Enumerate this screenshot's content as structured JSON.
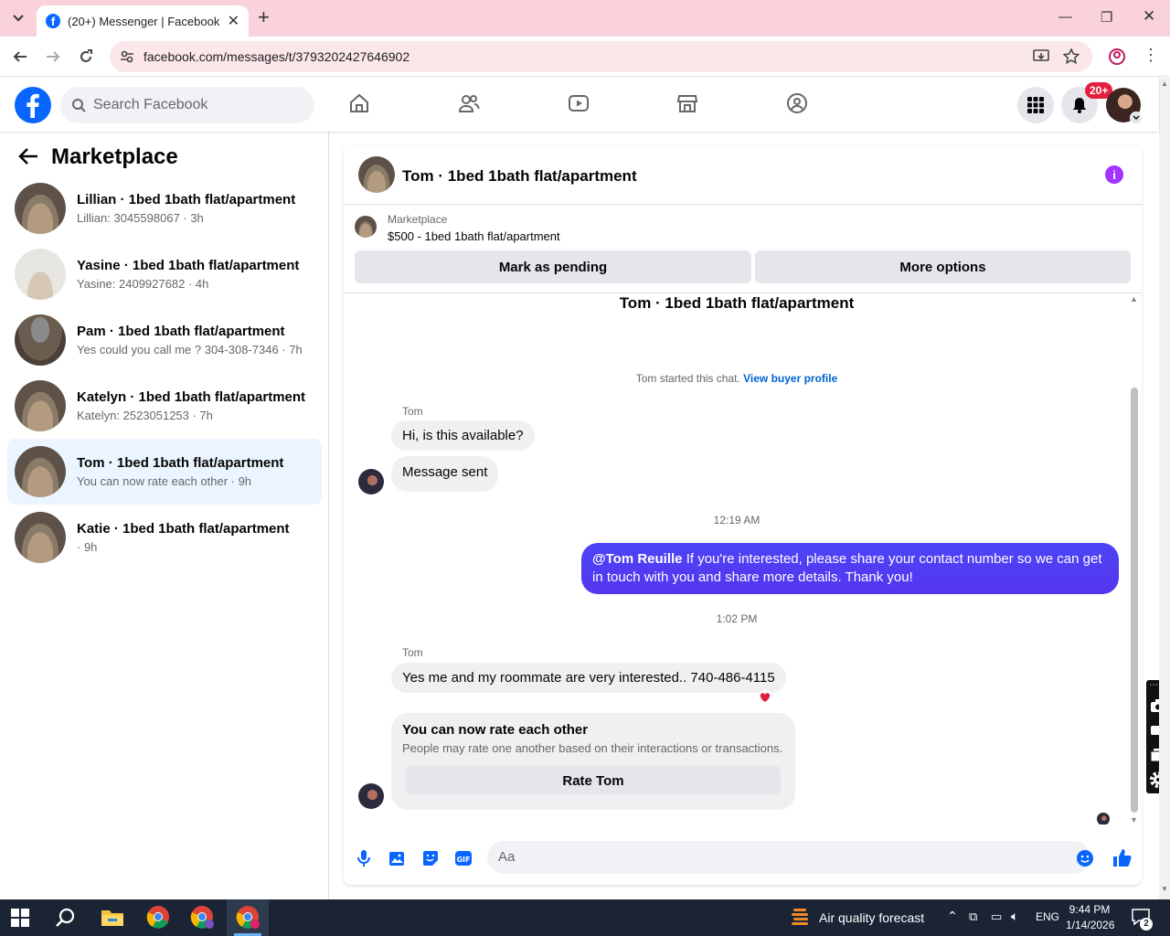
{
  "browser": {
    "tab_title": "(20+) Messenger | Facebook",
    "url": "facebook.com/messages/t/3793202427646902"
  },
  "fb_header": {
    "search_placeholder": "Search Facebook",
    "notification_badge": "20+"
  },
  "left_panel": {
    "title": "Marketplace",
    "conversations": [
      {
        "name": "Lillian · 1bed 1bath flat/apartment",
        "preview": "Lillian: 3045598067 · 3h"
      },
      {
        "name": "Yasine · 1bed 1bath flat/apartment",
        "preview": "Yasine: 2409927682 · 4h"
      },
      {
        "name": "Pam · 1bed 1bath flat/apartment",
        "preview": "Yes could you call me ? 304-308-7346 · 7h"
      },
      {
        "name": "Katelyn · 1bed 1bath flat/apartment",
        "preview": "Katelyn: 2523051253 · 7h"
      },
      {
        "name": "Tom · 1bed 1bath flat/apartment",
        "preview": "You can now rate each other · 9h"
      },
      {
        "name": "Katie · 1bed 1bath flat/apartment",
        "preview": " · 9h"
      }
    ]
  },
  "chat": {
    "header_title": "Tom · 1bed 1bath flat/apartment",
    "marketplace_label": "Marketplace",
    "listing_price_title": "$500 - 1bed 1bath flat/apartment",
    "mark_pending_label": "Mark as pending",
    "more_options_label": "More options",
    "thread_title": "Tom · 1bed 1bath flat/apartment",
    "started_text": "Tom started this chat.",
    "view_buyer_profile": "View buyer profile",
    "sender_name_1": "Tom",
    "msg_1": "Hi, is this available?",
    "msg_2": "Message sent",
    "timestamp_1": "12:19 AM",
    "out_mention": "@Tom Reuille",
    "out_text": " If you're interested, please share your contact number so we can get in touch with you and share more details. Thank you!",
    "timestamp_2": "1:02 PM",
    "sender_name_2": "Tom",
    "msg_3": "Yes me and my roommate are very interested.. 740-486-4115",
    "rate_title": "You can now rate each other",
    "rate_desc": "People may rate one another based on their interactions or transactions.",
    "rate_button": "Rate Tom",
    "composer_placeholder": "Aa"
  },
  "taskbar": {
    "weather_text": "Air quality forecast",
    "language": "ENG",
    "time": "9:44 PM",
    "date": "1/14/2026",
    "notification_count": "2"
  }
}
